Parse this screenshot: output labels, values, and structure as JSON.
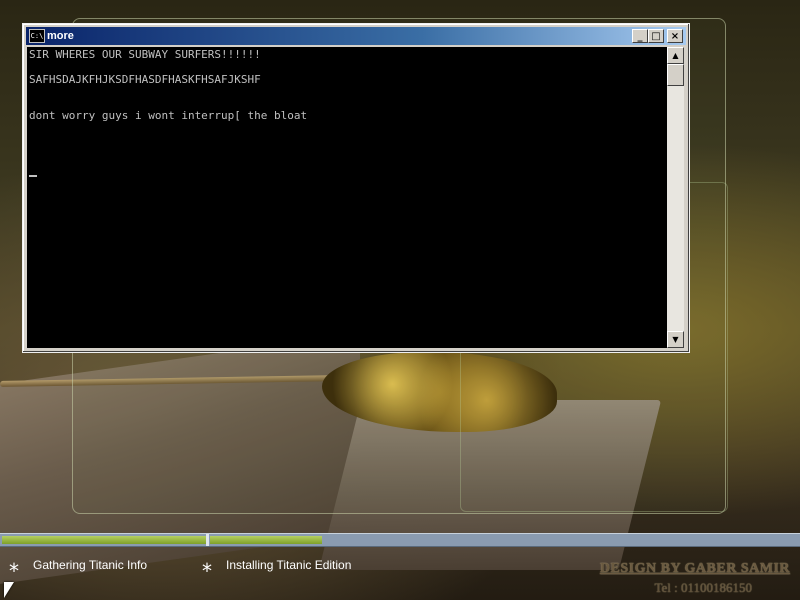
{
  "window": {
    "title": "more",
    "icon_label": "C:\\",
    "controls": [
      "minimize",
      "maximize",
      "close"
    ]
  },
  "console": {
    "lines": [
      "SIR WHERES OUR SUBWAY SURFERS!!!!!!",
      "SAFHSDAJKFHJKSDFHASDFHASKFHSAFJKSHF",
      "",
      "dont worry guys i wont interrup[ the bloat"
    ]
  },
  "progress": {
    "step1_fraction": 1.0,
    "step2_fraction": 0.19,
    "colors": {
      "fill": "#9dbf44",
      "track": "#8a9bb0"
    }
  },
  "steps": [
    {
      "label": "Gathering Titanic Info"
    },
    {
      "label": "Installing Titanic Edition"
    }
  ],
  "credit": {
    "design": "DESIGN BY GABER SAMIR",
    "tel": "Tel : 01100186150"
  }
}
